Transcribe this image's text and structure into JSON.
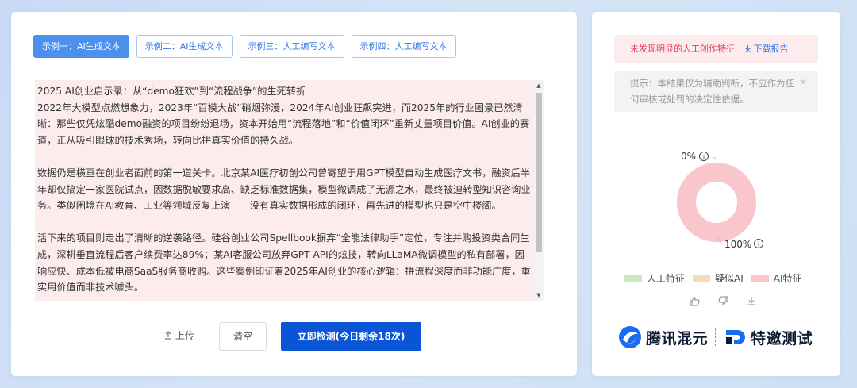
{
  "tabs": [
    {
      "label": "示例一：AI生成文本",
      "active": true
    },
    {
      "label": "示例二：AI生成文本",
      "active": false
    },
    {
      "label": "示例三：人工编写文本",
      "active": false
    },
    {
      "label": "示例四：人工编写文本",
      "active": false
    }
  ],
  "editor": {
    "lines": [
      "2025 AI创业启示录：从“demo狂欢”到“流程战争”的生死转折",
      "2022年大模型点燃想象力，2023年“百模大战”硝烟弥漫，2024年AI创业狂飙突进，而2025年的行业图景已然清晰：那些仅凭炫酷demo融资的项目纷纷退场，资本开始用“流程落地”和“价值闭环”重新丈量项目价值。AI创业的赛道，正从吸引眼球的技术秀场，转向比拼真实价值的持久战。",
      "数据仍是横亘在创业者面前的第一道关卡。北京某AI医疗初创公司曾寄望于用GPT模型自动生成医疗文书，融资后半年却仅搞定一家医院试点，因数据脱敏要求高、缺乏标准数据集，模型微调成了无源之水，最终被迫转型知识咨询业务。类似困境在AI教育、工业等领域反复上演——没有真实数据形成的闭环，再先进的模型也只是空中楼阁。",
      "活下来的项目则走出了清晰的逆袭路径。硅谷创业公司Spellbook摒弃“全能法律助手”定位，专注并购投资类合同生成，深耕垂直流程后客户续费率达89%；某AI客服公司放弃GPT API的炫技，转向LLaMA微调模型的私有部署，因响应快、成本低被电商SaaS服务商收购。这些案例印证着2025年AI创业的核心逻辑：拼流程深度而非功能广度，重实用价值而非技术噱头。"
    ]
  },
  "actions": {
    "upload_label": "上传",
    "clear_label": "清空",
    "detect_label": "立即检测(今日剩余18次)"
  },
  "result": {
    "alert_text": "未发现明显的人工创作特征",
    "download_label": "下载报告",
    "tip_text": "提示：本结果仅为辅助判断，不应作为任何审核或处罚的决定性依据。"
  },
  "chart_data": {
    "type": "pie",
    "donut": true,
    "categories": [
      "人工特征",
      "疑似AI",
      "AI特征"
    ],
    "values": [
      0,
      0,
      100
    ],
    "colors": [
      "#c9eac0",
      "#f6dcb6",
      "#f9c7cb"
    ],
    "labels_shown": [
      "0%",
      "100%"
    ],
    "legend_position": "bottom"
  },
  "icons": {
    "upload": "upload-icon",
    "download": "download-icon",
    "close": "close-icon",
    "info": "info-icon",
    "thumbs_up": "thumbs-up-icon",
    "thumbs_down": "thumbs-down-icon"
  },
  "brand": {
    "name1": "腾讯混元",
    "name2": "特邀测试",
    "colors": {
      "logo_blue": "#1a6cf2",
      "logo_dark": "#0d1b33"
    }
  }
}
